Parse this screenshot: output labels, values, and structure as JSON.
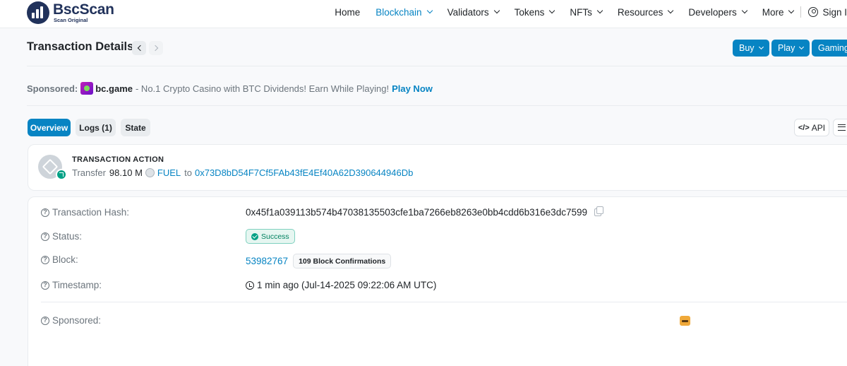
{
  "brand": {
    "name": "BscScan",
    "tagline": "Scan Original"
  },
  "nav": {
    "items": [
      {
        "label": "Home",
        "dropdown": false,
        "active": false
      },
      {
        "label": "Blockchain",
        "dropdown": true,
        "active": true
      },
      {
        "label": "Validators",
        "dropdown": true,
        "active": false
      },
      {
        "label": "Tokens",
        "dropdown": true,
        "active": false
      },
      {
        "label": "NFTs",
        "dropdown": true,
        "active": false
      },
      {
        "label": "Resources",
        "dropdown": true,
        "active": false
      },
      {
        "label": "Developers",
        "dropdown": true,
        "active": false
      },
      {
        "label": "More",
        "dropdown": true,
        "active": false
      }
    ],
    "signin_label": "Sign I"
  },
  "page": {
    "title": "Transaction Details",
    "buttons": {
      "buy": "Buy",
      "play": "Play",
      "gaming": "Gaming"
    }
  },
  "sponsored": {
    "label": "Sponsored:",
    "brand": "bc.game",
    "text": "- No.1 Crypto Casino with BTC Dividends! Earn While Playing!",
    "link": "Play Now"
  },
  "tabs": {
    "overview": "Overview",
    "logs": "Logs (1)",
    "state": "State",
    "api": "API"
  },
  "action": {
    "title": "TRANSACTION ACTION",
    "verb": "Transfer",
    "amount": "98.10 M",
    "token": "FUEL",
    "to_word": "to",
    "to_address": "0x73D8bD54F7Cf5FAb43fE4Ef40A62D390644946Db"
  },
  "details": {
    "hash_label": "Transaction Hash:",
    "hash_value": "0x45f1a039113b574b47038135503cfe1ba7266eb8263e0bb4cdd6b316e3dc7599",
    "status_label": "Status:",
    "status_value": "Success",
    "block_label": "Block:",
    "block_value": "53982767",
    "block_confirmations": "109 Block Confirmations",
    "timestamp_label": "Timestamp:",
    "timestamp_value": "1 min ago (Jul-14-2025 09:22:06 AM UTC)",
    "sponsored_label": "Sponsored:"
  },
  "colors": {
    "accent": "#0784c3",
    "success": "#00a186",
    "brand_dark": "#21325b"
  }
}
